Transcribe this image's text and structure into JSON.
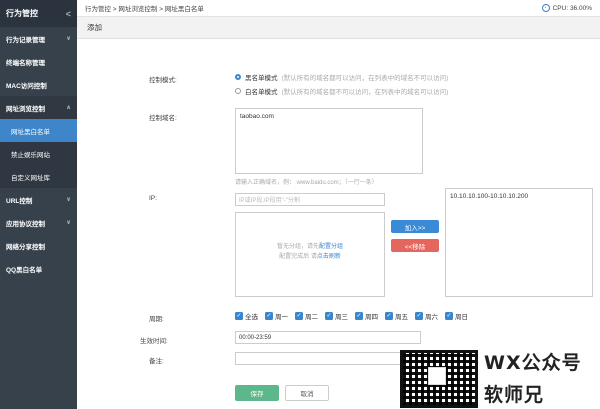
{
  "sidebar": {
    "title": "行为管控",
    "items": [
      {
        "label": "行为记录管理",
        "chev": "∨"
      },
      {
        "label": "终端名称管理"
      },
      {
        "label": "MAC访问控制"
      },
      {
        "label": "网址浏览控制",
        "chev": "∧"
      }
    ],
    "subitems": [
      {
        "label": "网址黑白名单"
      },
      {
        "label": "禁止娱乐网站"
      },
      {
        "label": "自定义网址库"
      }
    ],
    "items_after": [
      {
        "label": "URL控制",
        "chev": "∨"
      },
      {
        "label": "应用协议控制",
        "chev": "∨"
      },
      {
        "label": "网络分享控制"
      },
      {
        "label": "QQ黑白名单"
      }
    ]
  },
  "topbar": {
    "breadcrumb": "行为管控 > 网址浏览控制 > 网址黑白名单",
    "cpu": "CPU: 36.00%"
  },
  "page_title": "添加",
  "form": {
    "mode_label": "控制模式:",
    "black_mode": "黑名单模式",
    "black_hint": "(默认所有的域名都可以访问，在列表中的域名不可以访问)",
    "white_mode": "白名单模式",
    "white_hint": "(默认所有的域名都不可以访问，在列表中的域名可以访问)",
    "domain_label": "控制域名:",
    "domain_value": "taobao.com",
    "domain_hint": "请输入正确域名，例： www.baidu.com；（一行一条）",
    "ip_label": "IP:",
    "ip_placeholder": "IP或IP段,IP段用\"-\"分割",
    "empty_text1": "暂无分组，请先",
    "empty_link1": "配置分组",
    "empty_text2": "配置完成后 请",
    "empty_link2": "点击刷新",
    "add_btn": "加入>>",
    "remove_btn": "<<移除",
    "ip_list": [
      "10.10.10.100-10.10.10.200"
    ],
    "period_label": "周期:",
    "days": [
      "全选",
      "周一",
      "周二",
      "周三",
      "周四",
      "周五",
      "周六",
      "周日"
    ],
    "time_label": "生效时间:",
    "time_value": "00:00-23:59",
    "note_label": "备注:",
    "save_btn": "保存",
    "cancel_btn": "取消"
  },
  "watermark": {
    "line1": "WX公众号",
    "line2": "软师兄"
  }
}
